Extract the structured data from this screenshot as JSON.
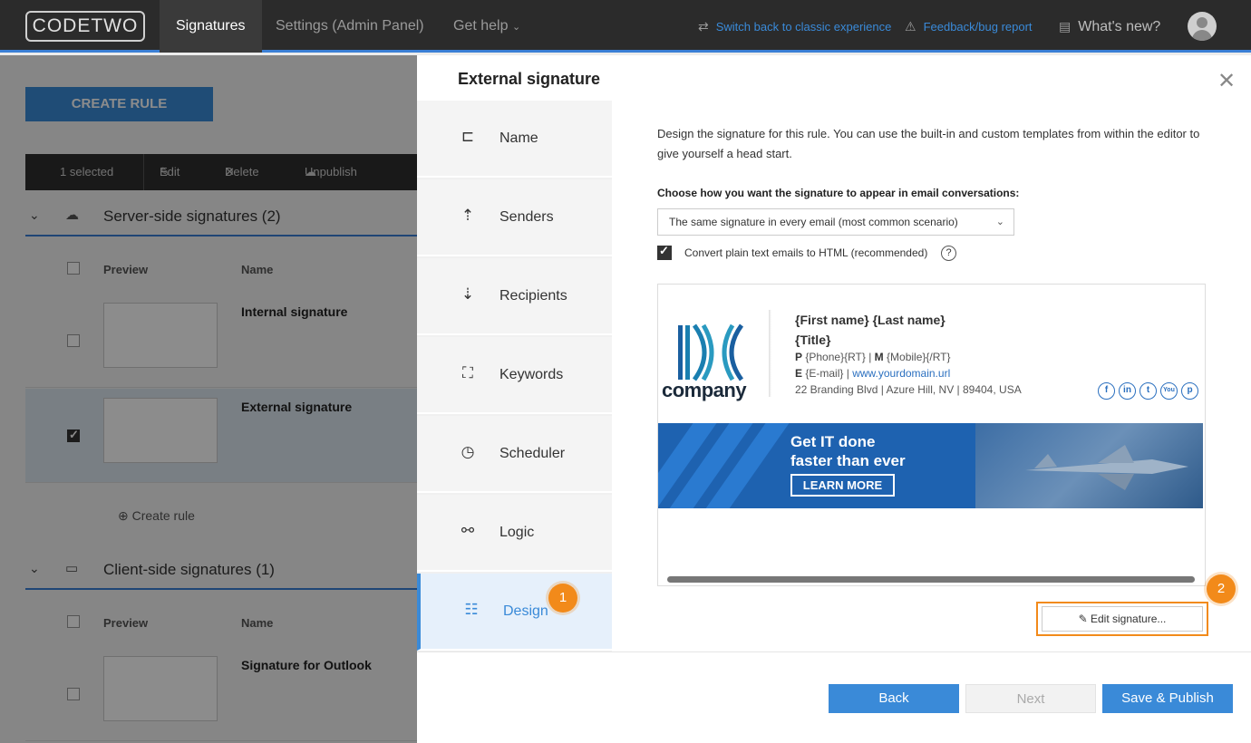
{
  "topbar": {
    "logo": "CODETWO",
    "tabs": [
      "Signatures",
      "Settings (Admin Panel)",
      "Get help"
    ],
    "switch_classic": "Switch back to classic experience",
    "feedback": "Feedback/bug report",
    "whats_new": "What's new?"
  },
  "bg": {
    "create_rule": "CREATE RULE",
    "actions": {
      "selected": "1 selected",
      "edit": "Edit",
      "delete": "Delete",
      "unpublish": "Unpublish"
    },
    "sections": [
      {
        "title": "Server-side signatures (2)",
        "col_preview": "Preview",
        "col_name": "Name",
        "rows": [
          {
            "name": "Internal signature"
          },
          {
            "name": "External signature"
          }
        ]
      },
      {
        "title": "Client-side signatures (1)",
        "col_preview": "Preview",
        "col_name": "Name",
        "rows": [
          {
            "name": "Signature for Outlook"
          }
        ]
      }
    ],
    "create_link": "Create rule"
  },
  "modal": {
    "title": "External signature",
    "steps": [
      "Name",
      "Senders",
      "Recipients",
      "Keywords",
      "Scheduler",
      "Logic",
      "Design"
    ],
    "active_step": "Design",
    "badge1": "1",
    "badge2": "2",
    "intro": "Design the signature for this rule. You can use the built-in and custom templates from within the editor to give yourself a head start.",
    "choose_label": "Choose how you want the signature to appear in email conversations:",
    "select_value": "The same signature in every email (most common scenario)",
    "convert_label": "Convert plain text emails to HTML (recommended)",
    "help": "?",
    "signature": {
      "company": "company",
      "name": "{First name} {Last name}",
      "title": "{Title}",
      "p_label": "P",
      "p_value": "{Phone}{RT}",
      "m_label": "M",
      "m_value": "{Mobile}{/RT}",
      "e_label": "E",
      "e_value": "{E-mail}",
      "website": "www.yourdomain.url",
      "address": "22 Branding Blvd | Azure Hill, NV | 89404, USA",
      "social": [
        "f",
        "in",
        "t",
        "You",
        "p"
      ],
      "banner_line1": "Get IT done",
      "banner_line2": "faster than ever",
      "banner_button": "LEARN MORE"
    },
    "edit_signature": "Edit signature...",
    "buttons": {
      "back": "Back",
      "next": "Next",
      "save": "Save & Publish"
    }
  },
  "colors": {
    "accent": "#3a8ad8",
    "badge": "#f28a1a",
    "topbar": "#2b2b2b"
  }
}
